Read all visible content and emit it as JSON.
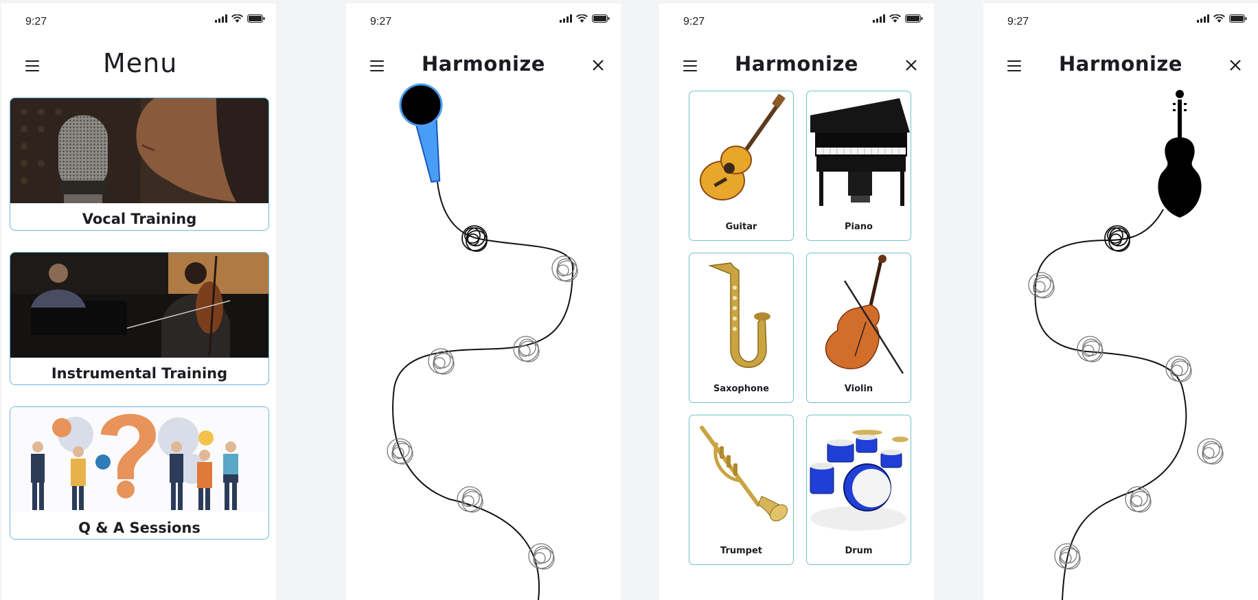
{
  "status": {
    "time": "9:27"
  },
  "menu_screen": {
    "title": "Menu",
    "cards": [
      {
        "label": "Vocal Training"
      },
      {
        "label": "Instrumental Training"
      },
      {
        "label": "Q & A Sessions"
      }
    ]
  },
  "vocal_screen": {
    "title": "Harmonize"
  },
  "instruments_screen": {
    "title": "Harmonize",
    "instruments": [
      {
        "label": "Guitar"
      },
      {
        "label": "Piano"
      },
      {
        "label": "Saxophone"
      },
      {
        "label": "Violin"
      },
      {
        "label": "Trumpet"
      },
      {
        "label": "Drum"
      }
    ]
  },
  "violin_screen": {
    "title": "Harmonize"
  },
  "colors": {
    "accent_border": "#6ab7e6",
    "tile_border": "#6fc3cc",
    "mic_blue": "#4a9df5"
  },
  "icons": [
    "hamburger-menu-icon",
    "close-icon",
    "signal-icon",
    "wifi-icon",
    "battery-icon",
    "microphone-icon",
    "violin-icon"
  ]
}
